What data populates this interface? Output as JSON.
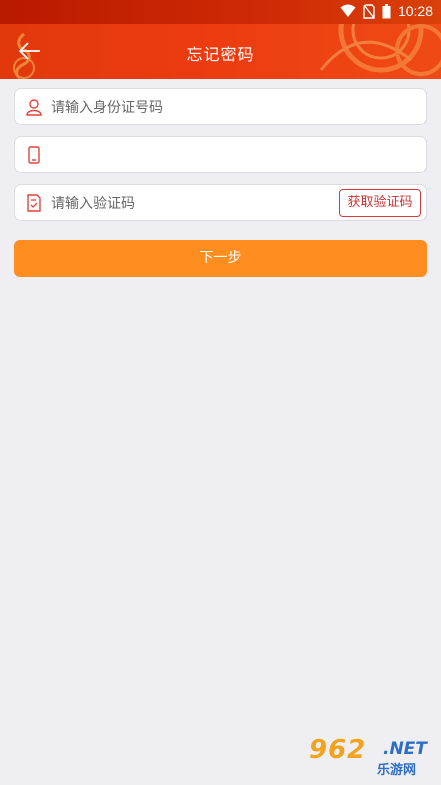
{
  "status": {
    "time": "10:28"
  },
  "header": {
    "title": "忘记密码"
  },
  "form": {
    "id_placeholder": "请输入身份证号码",
    "phone_placeholder": "",
    "code_placeholder": "请输入验证码",
    "get_code_label": "获取验证码",
    "next_label": "下一步"
  },
  "watermark": {
    "number": "962",
    "suffix": ".NET",
    "site": "乐游网"
  },
  "colors": {
    "header": "#ec3b10",
    "next_button": "#ff8d20",
    "code_button_border": "#d23c3c",
    "background": "#efeef3"
  }
}
